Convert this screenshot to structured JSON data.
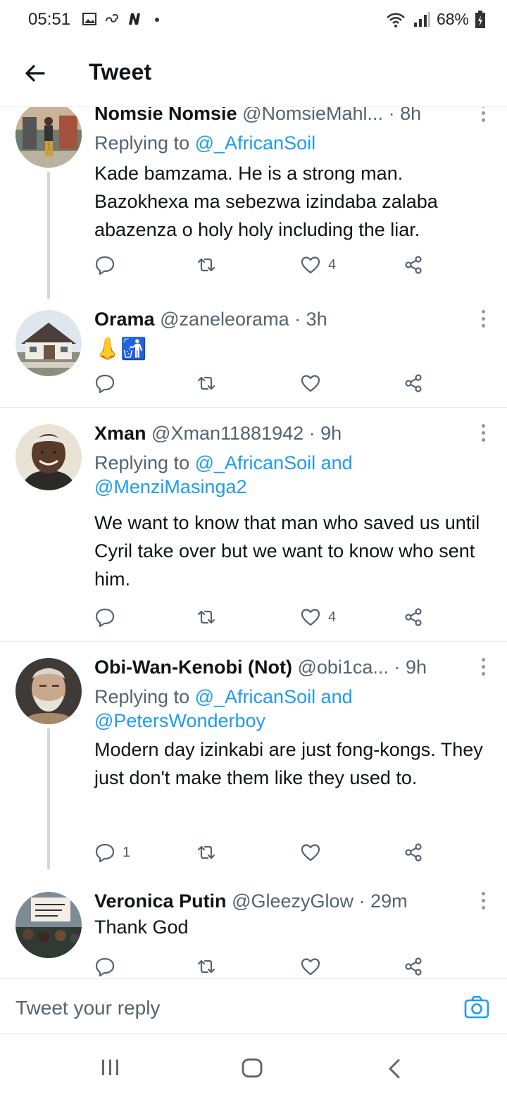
{
  "status_bar": {
    "time": "05:51",
    "battery": "68%",
    "icons": [
      "gallery-icon",
      "link-icon",
      "n-app-icon",
      "dot-icon",
      "wifi-icon",
      "signal-icon",
      "battery-icon"
    ]
  },
  "header": {
    "title": "Tweet",
    "back_icon": "arrow-left-icon"
  },
  "tweets": [
    {
      "name": "Nomsie Nomsie",
      "handle": "@NomsieMahl...",
      "time": "· 8h",
      "replying_prefix": "Replying to",
      "replying_to": "@_AfricanSoil",
      "text": "Kade bamzama. He is a strong man. Bazokhexa ma sebezwa izindaba zalaba abazenza o holy holy including the liar.",
      "reply_count": "",
      "like_count": "4"
    },
    {
      "name": "Orama",
      "handle": "@zaneleorama",
      "time": "· 3h",
      "text": "👃🚮",
      "reply_count": "",
      "like_count": ""
    },
    {
      "name": "Xman",
      "handle": "@Xman11881942",
      "time": "· 9h",
      "replying_prefix": "Replying to",
      "replying_to": "@_AfricanSoil and",
      "replying_to_2": "@MenziMasinga2",
      "text": "We want to know that man who saved us until Cyril take over but we want to know who sent him.",
      "reply_count": "",
      "like_count": "4"
    },
    {
      "name": "Obi-Wan-Kenobi (Not)",
      "handle": "@obi1ca...",
      "time": "· 9h",
      "replying_prefix": "Replying to",
      "replying_to": "@_AfricanSoil and",
      "replying_to_2": "@PetersWonderboy",
      "text": "Modern day izinkabi are just fong-kongs. They just don't make them like they used to.",
      "reply_count": "1",
      "like_count": ""
    },
    {
      "name": "Veronica Putin",
      "handle": "@GleezyGlow",
      "time": "· 29m",
      "text": "Thank God",
      "reply_count": "",
      "like_count": ""
    }
  ],
  "reply_bar": {
    "placeholder": "Tweet your reply"
  },
  "nav_bar": {
    "icons": [
      "recents-icon",
      "home-icon",
      "back-icon"
    ]
  },
  "colors": {
    "accent": "#1d9bf0",
    "text": "#0f1419",
    "muted": "#536471",
    "thread_line": "#cfd9de"
  }
}
